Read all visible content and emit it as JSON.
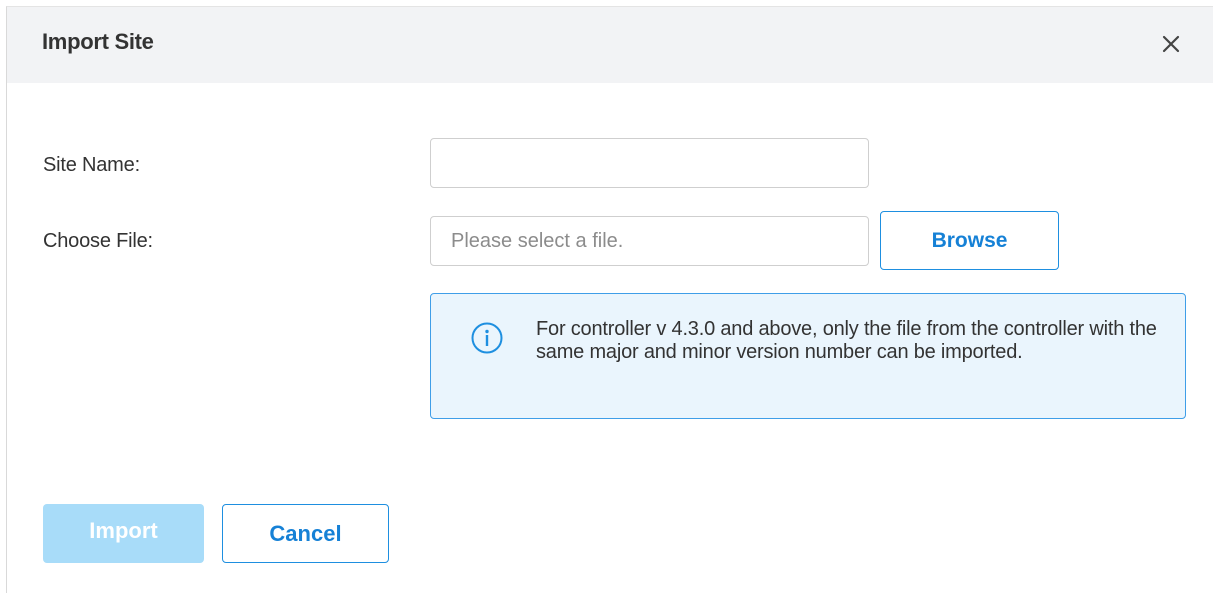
{
  "dialog": {
    "title": "Import Site",
    "close_icon": "close-icon"
  },
  "form": {
    "site_name": {
      "label": "Site Name:",
      "value": "",
      "placeholder": ""
    },
    "choose_file": {
      "label": "Choose File:",
      "value": "",
      "placeholder": "Please select a file.",
      "browse_label": "Browse"
    }
  },
  "info": {
    "icon": "info-icon",
    "text": "For controller v 4.3.0 and above, only the file from the controller with the same major and minor version number can be imported."
  },
  "footer": {
    "import_label": "Import",
    "import_disabled": true,
    "cancel_label": "Cancel"
  },
  "colors": {
    "accent": "#1681d6",
    "accent_border": "#1e8fe0",
    "disabled_button": "#a8dcf9",
    "info_background": "#eaf5fd",
    "info_border": "#3f9ee8",
    "header_background": "#f2f3f5"
  }
}
